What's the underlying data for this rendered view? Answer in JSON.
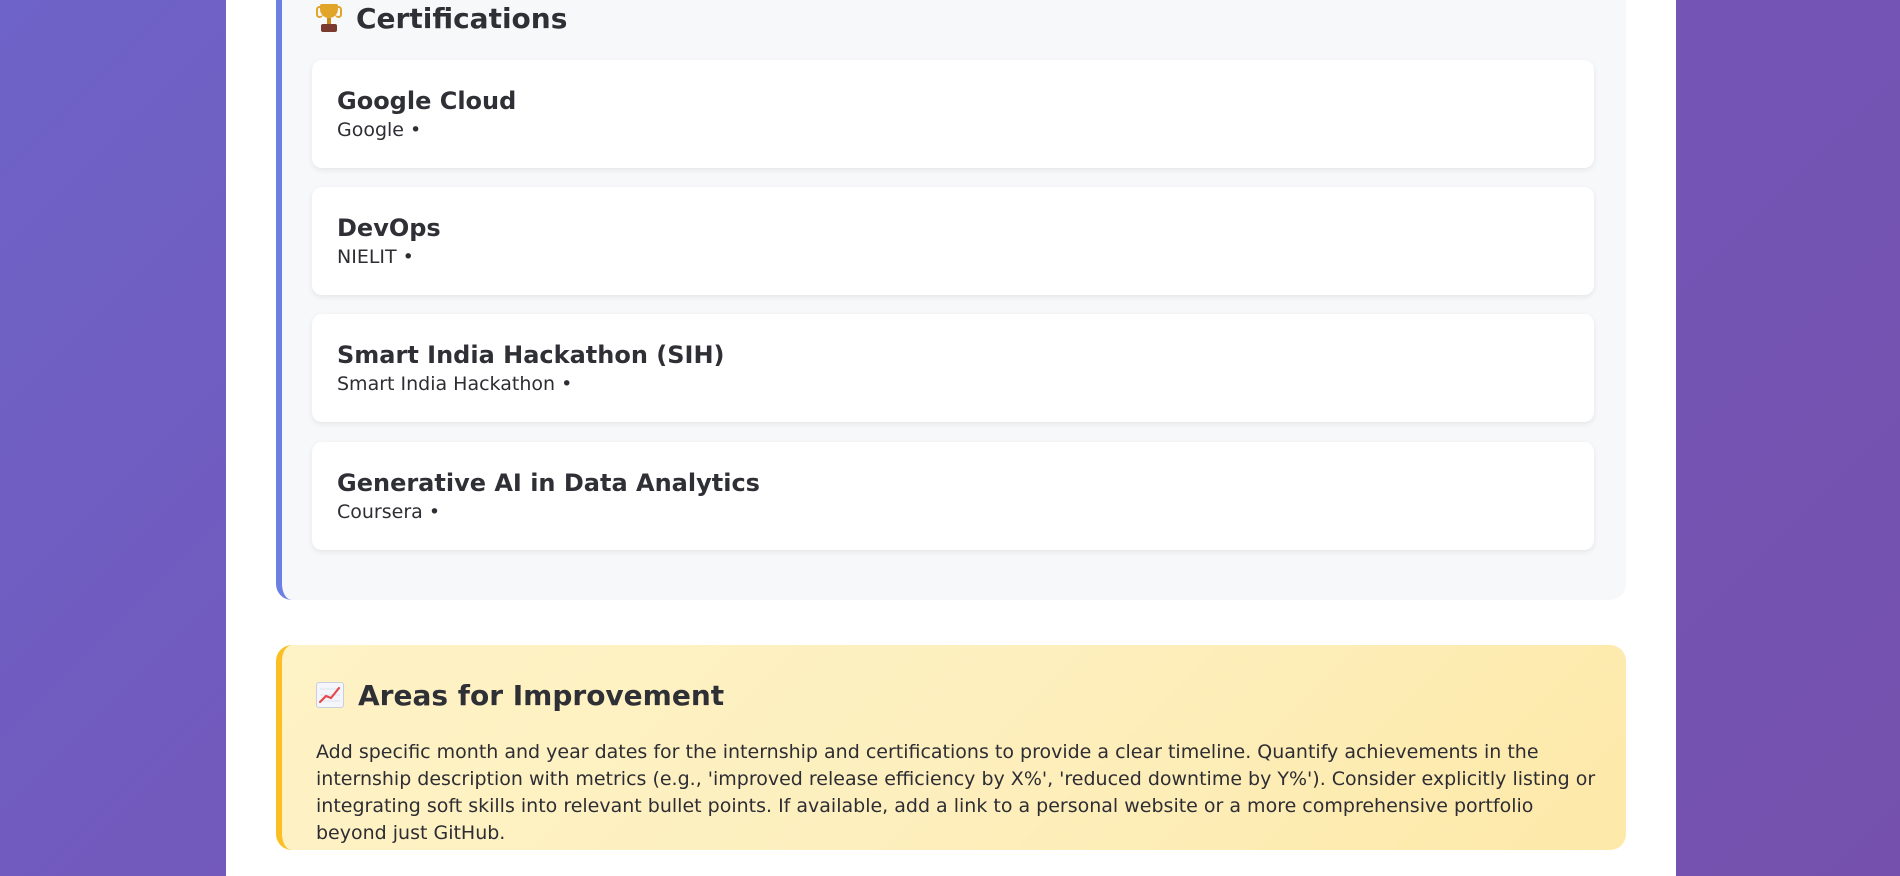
{
  "certifications": {
    "title": "Certifications",
    "icon": "trophy-icon",
    "items": [
      {
        "name": "Google Cloud",
        "issuer": "Google •"
      },
      {
        "name": "DevOps",
        "issuer": "NIELIT •"
      },
      {
        "name": "Smart India Hackathon (SIH)",
        "issuer": "Smart India Hackathon •"
      },
      {
        "name": "Generative AI in Data Analytics",
        "issuer": "Coursera •"
      }
    ]
  },
  "improvement": {
    "title": "Areas for Improvement",
    "icon": "chart-increasing-icon",
    "text": "Add specific month and year dates for the internship and certifications to provide a clear timeline. Quantify achievements in the internship description with metrics (e.g., 'improved release efficiency by X%', 'reduced downtime by Y%'). Consider explicitly listing or integrating soft skills into relevant bullet points. If available, add a link to a personal website or a more comprehensive portfolio beyond just GitHub."
  },
  "colors": {
    "background_gradient": "#7059bb",
    "cert_accent": "#6c7fe3",
    "improvement_accent": "#fbbf24",
    "improvement_background": "#fef3c6"
  }
}
